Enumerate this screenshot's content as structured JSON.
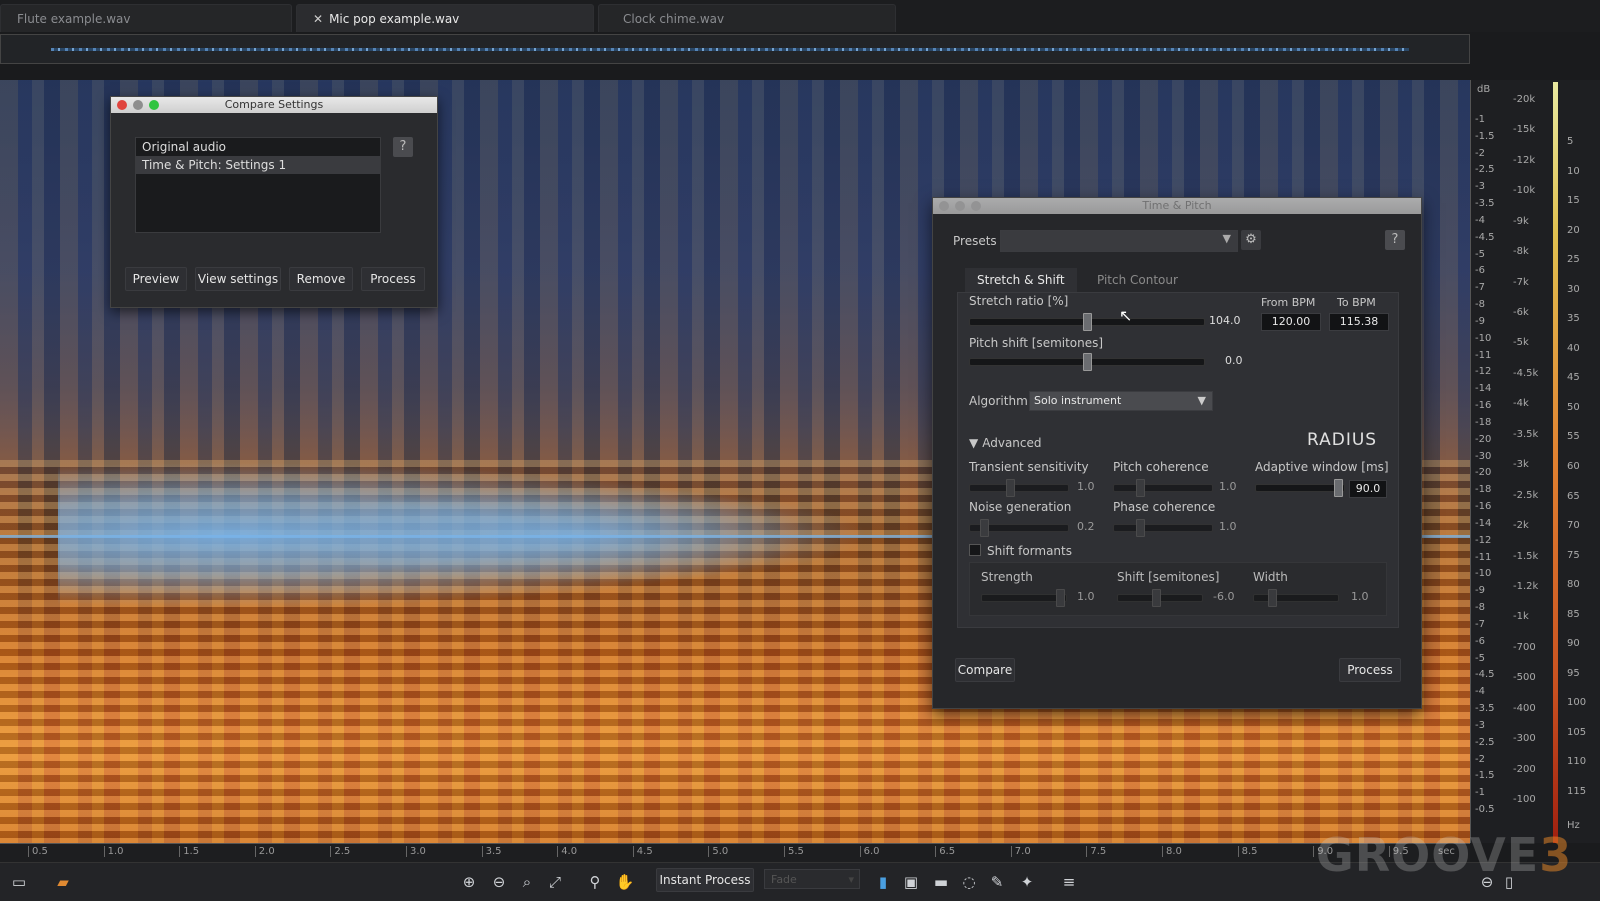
{
  "tabs": [
    {
      "label": "Flute example.wav",
      "active": false
    },
    {
      "label": "Mic pop example.wav",
      "active": true
    },
    {
      "label": "Clock chime.wav",
      "active": false
    }
  ],
  "compare": {
    "title": "Compare Settings",
    "list": [
      "Original audio",
      "Time & Pitch: Settings 1"
    ],
    "help": "?",
    "buttons": {
      "preview": "Preview",
      "view": "View settings",
      "remove": "Remove",
      "process": "Process"
    }
  },
  "tp": {
    "title": "Time & Pitch",
    "presets_label": "Presets",
    "help": "?",
    "tabs": {
      "stretch": "Stretch & Shift",
      "contour": "Pitch Contour"
    },
    "stretch_label": "Stretch ratio [%]",
    "stretch_value": "104.0",
    "stretch_level": 0.5,
    "from_bpm_label": "From BPM",
    "from_bpm": "120.00",
    "to_bpm_label": "To BPM",
    "to_bpm": "115.38",
    "pitch_label": "Pitch shift [semitones]",
    "pitch_value": "0.0",
    "pitch_level": 0.5,
    "algorithm_label": "Algorithm",
    "algorithm_value": "Solo instrument",
    "advanced_label": "Advanced",
    "radius": "RADIUS",
    "transient_label": "Transient sensitivity",
    "transient_value": "1.0",
    "pcoh_label": "Pitch coherence",
    "pcoh_value": "1.0",
    "adaptive_label": "Adaptive window [ms]",
    "adaptive_value": "90.0",
    "noise_label": "Noise generation",
    "noise_value": "0.2",
    "phase_label": "Phase coherence",
    "phase_value": "1.0",
    "formants_label": "Shift formants",
    "strength_label": "Strength",
    "strength_value": "1.0",
    "fshift_label": "Shift [semitones]",
    "fshift_value": "-6.0",
    "width_label": "Width",
    "width_value": "1.0",
    "compare_btn": "Compare",
    "process_btn": "Process"
  },
  "rulers": {
    "db_header": "dB",
    "db_ticks": [
      "-1",
      "-1.5",
      "-2",
      "-2.5",
      "-3",
      "-3.5",
      "-4",
      "-4.5",
      "-5",
      "-6",
      "-7",
      "-8",
      "-9",
      "-10",
      "-11",
      "-12",
      "-14",
      "-16",
      "-18",
      "-20",
      "-30",
      "-20",
      "-18",
      "-16",
      "-14",
      "-12",
      "-11",
      "-10",
      "-9",
      "-8",
      "-7",
      "-6",
      "-5",
      "-4.5",
      "-4",
      "-3.5",
      "-3",
      "-2.5",
      "-2",
      "-1.5",
      "-1",
      "-0.5"
    ],
    "hz_ticks": [
      "-20k",
      "-15k",
      "-12k",
      "-10k",
      "-9k",
      "-8k",
      "-7k",
      "-6k",
      "-5k",
      "-4.5k",
      "-4k",
      "-3.5k",
      "-3k",
      "-2.5k",
      "-2k",
      "-1.5k",
      "-1.2k",
      "-1k",
      "-700",
      "-500",
      "-400",
      "-300",
      "-200",
      "-100"
    ],
    "meter_ticks": [
      "5",
      "10",
      "15",
      "20",
      "25",
      "30",
      "35",
      "40",
      "45",
      "50",
      "55",
      "60",
      "65",
      "70",
      "75",
      "80",
      "85",
      "90",
      "95",
      "100",
      "105",
      "110",
      "115"
    ],
    "hz_unit": "Hz"
  },
  "timeline": [
    "0.5",
    "1.0",
    "1.5",
    "2.0",
    "2.5",
    "3.0",
    "3.5",
    "4.0",
    "4.5",
    "5.0",
    "5.5",
    "6.0",
    "6.5",
    "7.0",
    "7.5",
    "8.0",
    "8.5",
    "9.0",
    "9.5"
  ],
  "timeline_unit": "sec",
  "bottom": {
    "instant_process": "Instant Process",
    "fade": "Fade"
  },
  "watermark": {
    "a": "GROOVE",
    "b": "3"
  }
}
